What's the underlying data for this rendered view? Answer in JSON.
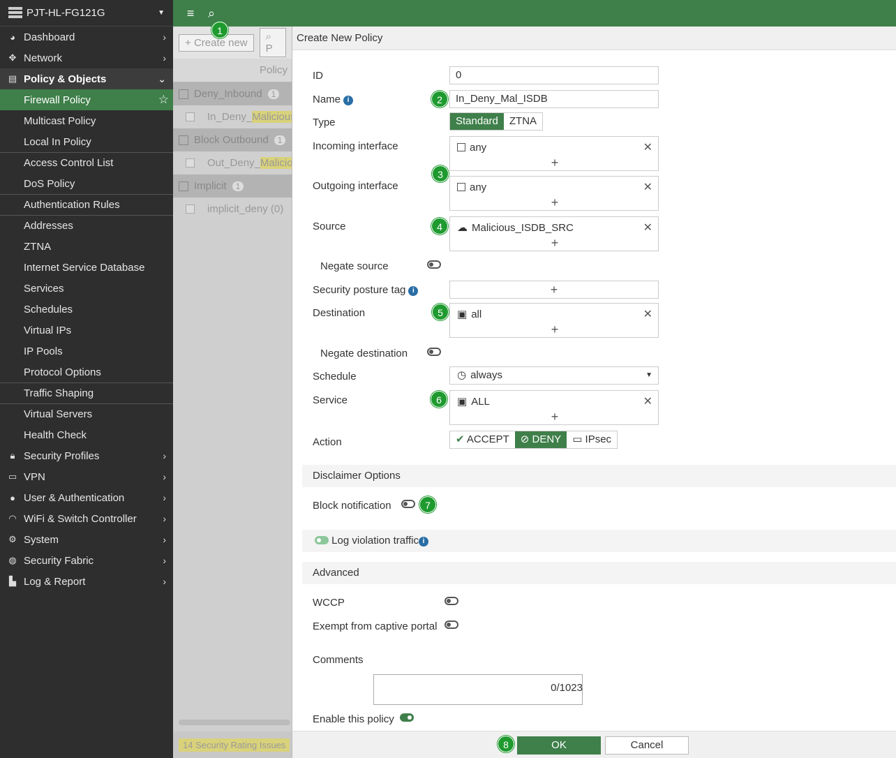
{
  "device": {
    "name": "PJT-HL-FG121G"
  },
  "sidebar": {
    "top_items": [
      {
        "label": "Dashboard",
        "icon": "dashboard-icon"
      },
      {
        "label": "Network",
        "icon": "network-icon"
      }
    ],
    "open_item": {
      "label": "Policy & Objects",
      "icon": "policy-icon"
    },
    "sub_items": [
      "Firewall Policy",
      "Multicast Policy",
      "Local In Policy",
      "Access Control List",
      "DoS Policy",
      "Authentication Rules",
      "Addresses",
      "ZTNA",
      "Internet Service Database",
      "Services",
      "Schedules",
      "Virtual IPs",
      "IP Pools",
      "Protocol Options",
      "Traffic Shaping",
      "Virtual Servers",
      "Health Check"
    ],
    "bottom_items": [
      "Security Profiles",
      "VPN",
      "User & Authentication",
      "WiFi & Switch Controller",
      "System",
      "Security Fabric",
      "Log & Report"
    ]
  },
  "background": {
    "create_label": "Create new",
    "search_label": "P",
    "col_header": "Policy",
    "groups": [
      {
        "name": "Deny_Inbound",
        "count": "1",
        "row_pre": "In_Deny_",
        "row_hl": "Malicious"
      },
      {
        "name": "Block Outbound",
        "count": "1",
        "row_pre": "Out_Deny_",
        "row_hl": "Malicio"
      },
      {
        "name": "Implicit",
        "count": "1",
        "row_pre": "implicit_deny (0)",
        "row_hl": ""
      }
    ],
    "footer_count": "14",
    "footer_label": "Security Rating Issues"
  },
  "panel": {
    "title": "Create New Policy",
    "labels": {
      "id": "ID",
      "name": "Name",
      "type": "Type",
      "incoming": "Incoming interface",
      "outgoing": "Outgoing interface",
      "source": "Source",
      "negate_source": "Negate source",
      "posture": "Security posture tag",
      "destination": "Destination",
      "negate_destination": "Negate destination",
      "schedule": "Schedule",
      "service": "Service",
      "action": "Action",
      "block_notification": "Block notification",
      "log_violation": "Log violation traffic",
      "wccp": "WCCP",
      "exempt": "Exempt from captive portal",
      "comments": "Comments",
      "enable": "Enable this policy"
    },
    "values": {
      "id": "0",
      "name": "In_Deny_Mal_ISDB",
      "incoming": "any",
      "outgoing": "any",
      "source": "Malicious_ISDB_SRC",
      "destination": "all",
      "schedule": "always",
      "service": "ALL",
      "comment_count": "0/1023"
    },
    "type_options": [
      "Standard",
      "ZTNA"
    ],
    "action_options": [
      "ACCEPT",
      "DENY",
      "IPsec"
    ],
    "sections": {
      "disclaimer": "Disclaimer Options",
      "advanced": "Advanced"
    },
    "buttons": {
      "ok": "OK",
      "cancel": "Cancel"
    },
    "glyphs": {
      "plus": "+",
      "close": "✕",
      "info": "i"
    }
  },
  "steps": [
    "1",
    "2",
    "3",
    "4",
    "5",
    "6",
    "7",
    "8"
  ],
  "colors": {
    "accent": "#3f7f4a",
    "badge": "#1f9a2f",
    "sidebar": "#2e2e2e"
  }
}
